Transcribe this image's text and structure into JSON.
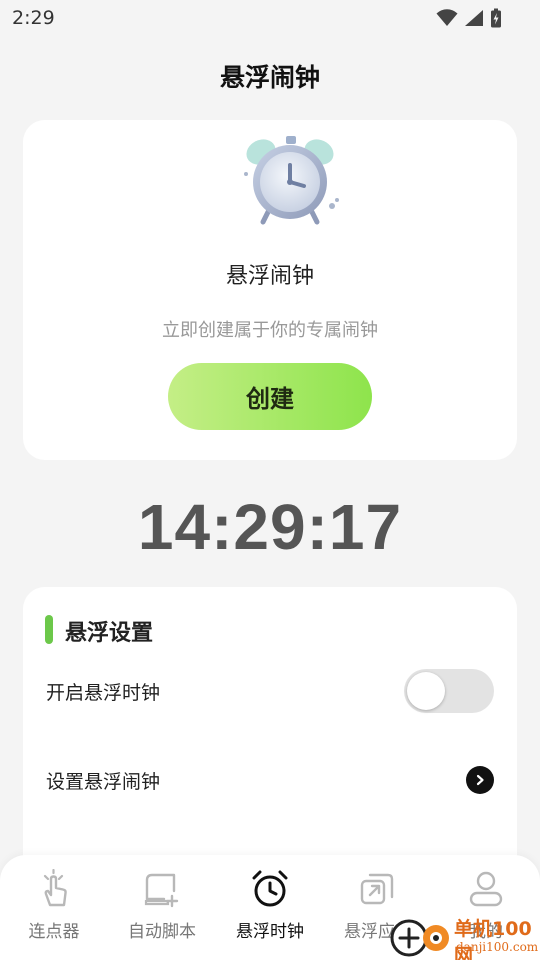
{
  "status_bar": {
    "time": "2:29",
    "icons": [
      "wifi-icon",
      "signal-icon",
      "battery-charging-icon"
    ]
  },
  "page": {
    "title": "悬浮闹钟"
  },
  "alarm_card": {
    "icon": "alarm-clock-illustration",
    "title": "悬浮闹钟",
    "subtitle": "立即创建属于你的专属闹钟",
    "create_label": "创建",
    "button_gradient": [
      "#c4ee86",
      "#8ee44c"
    ]
  },
  "clock": {
    "time": "14:29:17"
  },
  "settings": {
    "title": "悬浮设置",
    "accent_color": "#6cc84a",
    "rows": [
      {
        "label": "开启悬浮时钟",
        "control": "toggle",
        "on": false
      },
      {
        "label": "设置悬浮闹钟",
        "control": "chevron-right-icon"
      }
    ]
  },
  "bottom_nav": {
    "items": [
      {
        "label": "连点器",
        "icon": "tap-hand-icon",
        "active": false
      },
      {
        "label": "自动脚本",
        "icon": "script-icon",
        "active": false
      },
      {
        "label": "悬浮时钟",
        "icon": "alarm-clock-icon",
        "active": true
      },
      {
        "label": "悬浮应用",
        "icon": "floating-app-icon",
        "active": false
      },
      {
        "label": "我的",
        "icon": "user-icon",
        "active": false
      }
    ]
  },
  "watermark": {
    "line1": "单机100网",
    "line2": "danji100.com"
  }
}
